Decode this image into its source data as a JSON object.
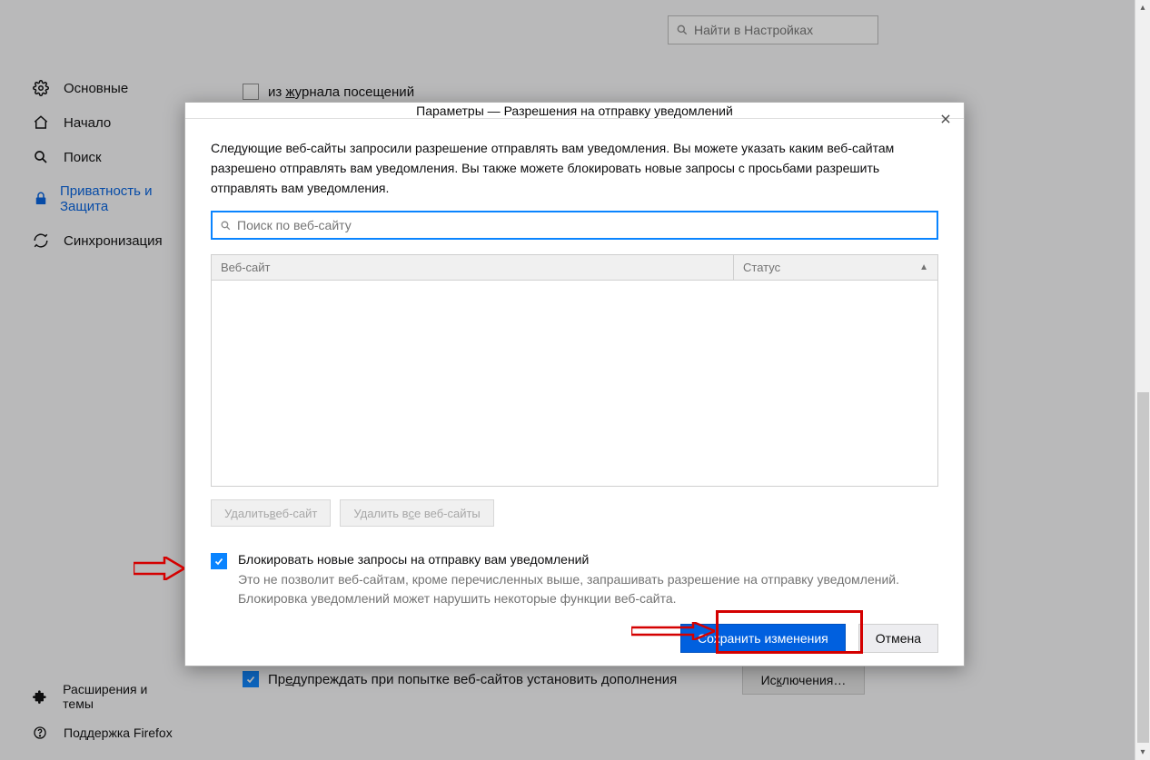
{
  "sidebar": {
    "items": [
      {
        "label": "Основные"
      },
      {
        "label": "Начало"
      },
      {
        "label": "Поиск"
      },
      {
        "label": "Приватность и Защита"
      },
      {
        "label": "Синхронизация"
      }
    ],
    "bottom": [
      {
        "label": "Расширения и темы"
      },
      {
        "label": "Поддержка Firefox"
      }
    ]
  },
  "page_search": {
    "placeholder": "Найти в Настройках"
  },
  "bg": {
    "history_label_pre": "из ",
    "history_label_underline": "ж",
    "history_label_post": "урнала посещений",
    "warn_pre": "Пр",
    "warn_under": "е",
    "warn_post": "дупреждать при попытке веб-сайтов установить дополнения",
    "exceptions_pre": "Ис",
    "exceptions_under": "к",
    "exceptions_post": "лючения…"
  },
  "dialog": {
    "title": "Параметры — Разрешения на отправку уведомлений",
    "description": "Следующие веб-сайты запросили разрешение отправлять вам уведомления. Вы можете указать каким веб-сайтам разрешено отправлять вам уведомления. Вы также можете блокировать новые запросы с просьбами разрешить отправлять вам уведомления.",
    "search_placeholder": "Поиск по веб-сайту",
    "col_site": "Веб-сайт",
    "col_status": "Статус",
    "remove_site_pre": "Удалить ",
    "remove_site_under": "в",
    "remove_site_post": "еб-сайт",
    "remove_all_pre": "Удалить в",
    "remove_all_under": "с",
    "remove_all_post": "е веб-сайты",
    "block_title": "Блокировать новые запросы на отправку вам уведомлений",
    "block_sub": "Это не позволит веб-сайтам, кроме перечисленных выше, запрашивать разрешение на отправку уведомлений. Блокировка уведомлений может нарушить некоторые функции веб-сайта.",
    "save": "Сохранить изменения",
    "cancel": "Отмена"
  }
}
